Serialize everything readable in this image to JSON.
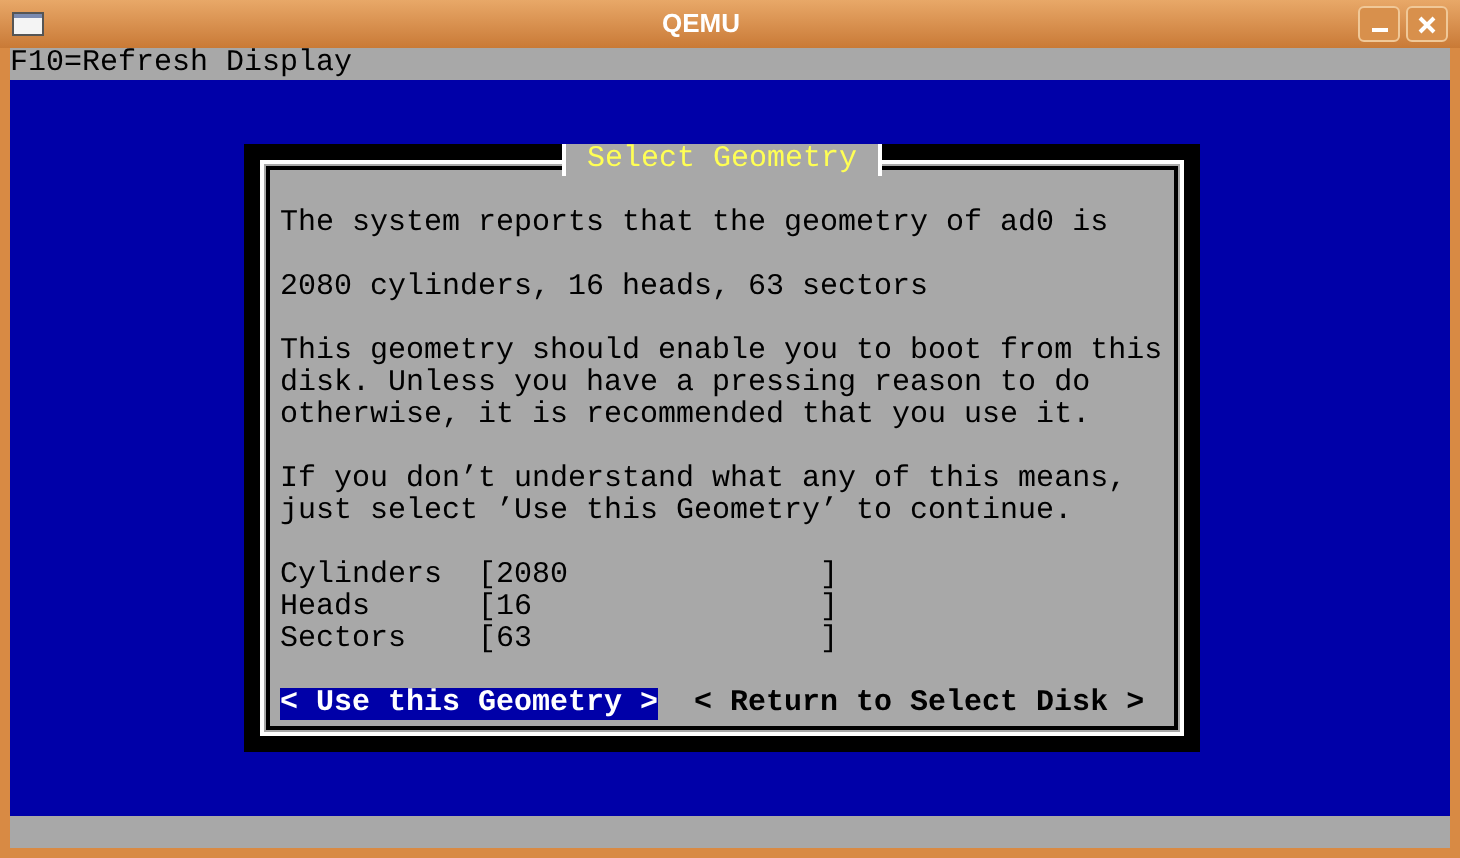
{
  "window": {
    "title": "QEMU"
  },
  "status_bar": {
    "text": "F10=Refresh Display"
  },
  "dialog": {
    "title": "Select Geometry",
    "paragraphs": [
      "The system reports that the geometry of ad0 is",
      "2080 cylinders, 16 heads, 63 sectors",
      "This geometry should enable you to boot from this\ndisk. Unless you have a pressing reason to do\notherwise, it is recommended that you use it.",
      "If you don’t understand what any of this means,\njust select ’Use this Geometry’ to continue."
    ],
    "fields": [
      {
        "label": "Cylinders",
        "open": "[",
        "value": "2080",
        "close": "]"
      },
      {
        "label": "Heads",
        "open": "[",
        "value": "16",
        "close": "]"
      },
      {
        "label": "Sectors",
        "open": "[",
        "value": "63",
        "close": "]"
      }
    ],
    "buttons": [
      {
        "label": "< Use this Geometry >",
        "selected": true
      },
      {
        "label": "< Return to Select Disk >",
        "selected": false
      }
    ]
  }
}
